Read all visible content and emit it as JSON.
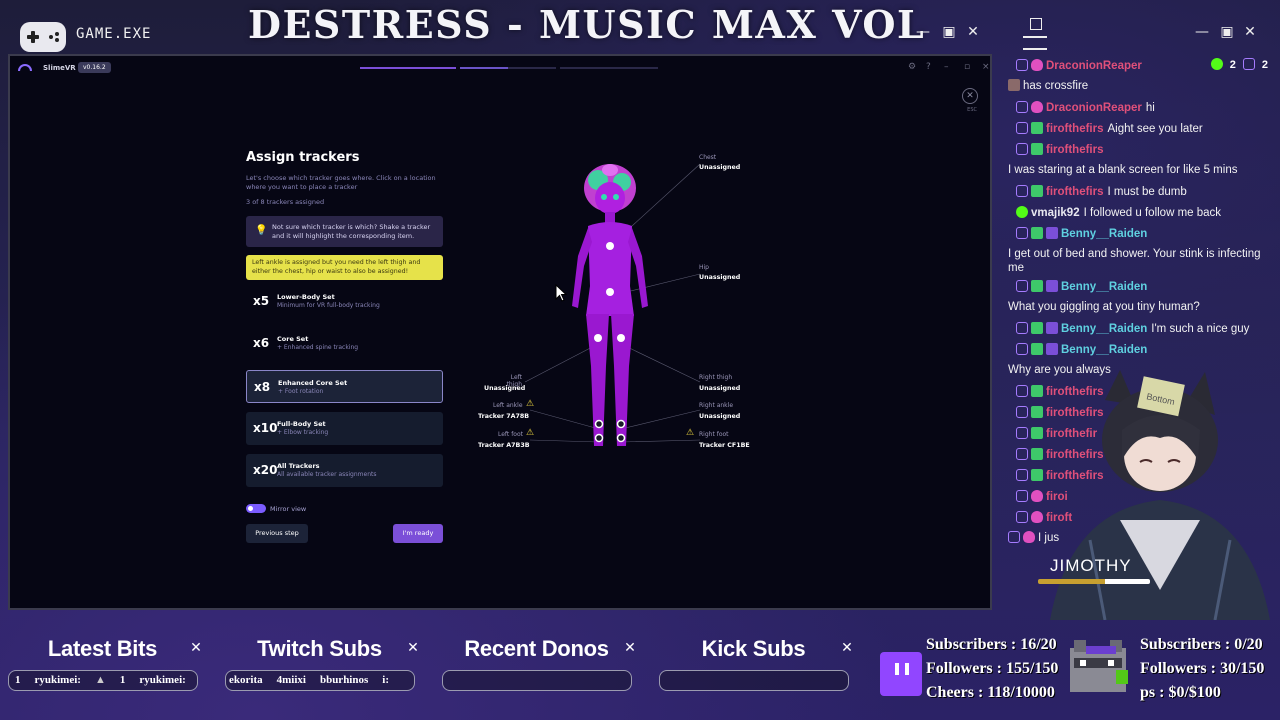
{
  "overlay": {
    "game_label": "GAME.EXE",
    "stream_title": "DESTRESS - MUSIC MAX VOL",
    "window_controls": [
      "—",
      "▣",
      "✕"
    ]
  },
  "slimevr": {
    "app_name": "SlimeVR",
    "version": "v0.16.2",
    "esc_label": "ESC",
    "title": "Assign trackers",
    "description": "Let's choose which tracker goes where. Click on a location where you want to place a tracker",
    "assigned_count": "3 of 8 trackers assigned",
    "hint": "Not sure which tracker is which? Shake a tracker and it will highlight the corresponding item.",
    "warning": "Left ankle is assigned but you need the left thigh and either the chest, hip or waist to also be assigned!",
    "sets": [
      {
        "count": "x5",
        "title": "Lower-Body Set",
        "sub": "Minimum for VR full-body tracking"
      },
      {
        "count": "x6",
        "title": "Core Set",
        "sub": "+ Enhanced spine tracking"
      },
      {
        "count": "x8",
        "title": "Enhanced Core Set",
        "sub": "+ Foot rotation"
      },
      {
        "count": "x10",
        "title": "Full-Body Set",
        "sub": "+ Elbow tracking"
      },
      {
        "count": "x20",
        "title": "All Trackers",
        "sub": "All available tracker assignments"
      }
    ],
    "mirror_label": "Mirror view",
    "prev_label": "Previous step",
    "ready_label": "I'm ready",
    "trackers": {
      "chest": {
        "label": "Chest",
        "value": "Unassigned"
      },
      "hip": {
        "label": "Hip",
        "value": "Unassigned"
      },
      "left_thigh": {
        "label": "Left thigh",
        "value": "Unassigned"
      },
      "right_thigh": {
        "label": "Right thigh",
        "value": "Unassigned"
      },
      "left_ankle": {
        "label": "Left ankle",
        "value": "Tracker 7A78B"
      },
      "right_ankle": {
        "label": "Right ankle",
        "value": "Unassigned"
      },
      "left_foot": {
        "label": "Left foot",
        "value": "Tracker A7B3B"
      },
      "right_foot": {
        "label": "Right foot",
        "value": "Tracker CF1BE"
      }
    }
  },
  "chat": {
    "counters": {
      "kick": "2",
      "twitch": "2"
    },
    "messages": [
      {
        "user": "DraconionReaper",
        "color": "#e0507a",
        "text": "",
        "badges": [
          "twitch",
          "heart"
        ]
      },
      {
        "user": "",
        "color": "#fff",
        "text": "has crossfire",
        "badges": [
          "avatar"
        ]
      },
      {
        "user": "DraconionReaper",
        "color": "#e0507a",
        "text": "hi",
        "badges": [
          "twitch",
          "heart"
        ]
      },
      {
        "user": "firofthefirs",
        "color": "#e0507a",
        "text": "Aight see you later",
        "badges": [
          "twitch",
          "green"
        ]
      },
      {
        "user": "firofthefirs",
        "color": "#e0507a",
        "text": "",
        "badges": [
          "twitch",
          "green"
        ]
      },
      {
        "user": "",
        "color": "#fff",
        "text": "I was staring at a blank screen for like 5 mins",
        "badges": []
      },
      {
        "user": "firofthefirs",
        "color": "#e0507a",
        "text": "I must be dumb",
        "badges": [
          "twitch",
          "green"
        ]
      },
      {
        "user": "vmajik92",
        "color": "#e8e8f0",
        "text": "I followed u follow me back",
        "badges": [
          "kick"
        ]
      },
      {
        "user": "Benny__Raiden",
        "color": "#5fd0e0",
        "text": "",
        "badges": [
          "twitch",
          "green",
          "sub"
        ]
      },
      {
        "user": "",
        "color": "#fff",
        "text": "I get out of bed and shower. Your stink is infecting me",
        "badges": []
      },
      {
        "user": "Benny__Raiden",
        "color": "#5fd0e0",
        "text": "",
        "badges": [
          "twitch",
          "green",
          "sub"
        ]
      },
      {
        "user": "",
        "color": "#fff",
        "text": "What you giggling at you tiny human?",
        "badges": []
      },
      {
        "user": "Benny__Raiden",
        "color": "#5fd0e0",
        "text": "I'm such a nice guy",
        "badges": [
          "twitch",
          "green",
          "sub"
        ]
      },
      {
        "user": "Benny__Raiden",
        "color": "#5fd0e0",
        "text": "",
        "badges": [
          "twitch",
          "green",
          "sub"
        ]
      },
      {
        "user": "",
        "color": "#fff",
        "text": "Why are you always",
        "badges": []
      },
      {
        "user": "firofthefirs",
        "color": "#e0507a",
        "text": "",
        "badges": [
          "twitch",
          "green"
        ]
      },
      {
        "user": "firofthefirs",
        "color": "#e0507a",
        "text": "",
        "badges": [
          "twitch",
          "green"
        ]
      },
      {
        "user": "firofthefir",
        "color": "#e0507a",
        "text": "",
        "badges": [
          "twitch",
          "green"
        ]
      },
      {
        "user": "firofthefirs",
        "color": "#e0507a",
        "text": "",
        "badges": [
          "twitch",
          "green"
        ]
      },
      {
        "user": "firofthefirs",
        "color": "#e0507a",
        "text": "",
        "badges": [
          "twitch",
          "green"
        ]
      },
      {
        "user": "firoi",
        "color": "#e0507a",
        "text": "",
        "badges": [
          "twitch",
          "heart"
        ]
      },
      {
        "user": "firoft",
        "color": "#e0507a",
        "text": "",
        "badges": [
          "twitch",
          "heart"
        ]
      },
      {
        "user": "",
        "color": "#fff",
        "text": "I jus",
        "badges": [
          "twitch",
          "heart"
        ]
      }
    ]
  },
  "vtuber": {
    "name": "JIMOTHY",
    "note": "Bottom"
  },
  "panels": [
    {
      "title": "Latest Bits",
      "ticker": [
        "1",
        "ryukimei:",
        "1",
        "ryukimei:"
      ]
    },
    {
      "title": "Twitch Subs",
      "ticker": [
        "ekorita",
        "4miixi",
        "bburhinos",
        "i:"
      ]
    },
    {
      "title": "Recent Donos",
      "ticker": []
    },
    {
      "title": "Kick Subs",
      "ticker": []
    }
  ],
  "stats": {
    "left": [
      "Subscribers : 16/20",
      "Followers : 155/150",
      "Cheers : 118/10000"
    ],
    "right": [
      "Subscribers : 0/20",
      "Followers : 30/150",
      "ps : $0/$100"
    ]
  },
  "colors": {
    "accent": "#7b4fd8",
    "warning": "#e6e24a",
    "twitch": "#9146ff",
    "kick": "#53fc18"
  }
}
